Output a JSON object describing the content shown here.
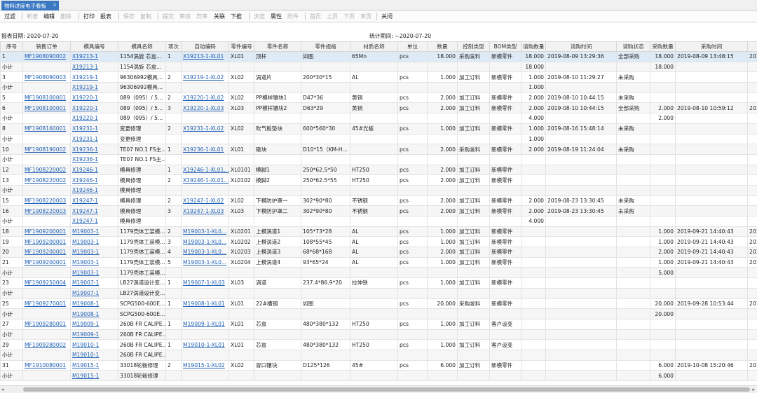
{
  "window": {
    "tab_title": "物料进度电子看板",
    "close_glyph": "×"
  },
  "toolbar": {
    "items": [
      {
        "label": "过滤",
        "enabled": true
      },
      {
        "label": "新增",
        "enabled": false
      },
      {
        "label": "编辑",
        "enabled": true
      },
      {
        "label": "删除",
        "enabled": false
      },
      {
        "label": "打印",
        "enabled": true
      },
      {
        "label": "报表",
        "enabled": true
      },
      {
        "label": "保存",
        "enabled": false
      },
      {
        "label": "复制",
        "enabled": false
      },
      {
        "label": "提交",
        "enabled": false
      },
      {
        "label": "审核",
        "enabled": false
      },
      {
        "label": "弃审",
        "enabled": false
      },
      {
        "label": "关联",
        "enabled": true
      },
      {
        "label": "下推",
        "enabled": true
      },
      {
        "label": "浏览",
        "enabled": false
      },
      {
        "label": "属性",
        "enabled": true
      },
      {
        "label": "附件",
        "enabled": false
      },
      {
        "label": "首页",
        "enabled": false
      },
      {
        "label": "上页",
        "enabled": false
      },
      {
        "label": "下页",
        "enabled": false
      },
      {
        "label": "末页",
        "enabled": false
      },
      {
        "label": "关闭",
        "enabled": true
      }
    ]
  },
  "info": {
    "report_date": "报表日期: 2020-07-20",
    "stat_period": "统计期间: ~2020-07-20"
  },
  "table": {
    "columns": [
      "序号",
      "销售订单",
      "模具编号",
      "模具名称",
      "项次",
      "自动编码",
      "零件编号",
      "零件名称",
      "零件规格",
      "材质名称",
      "单位",
      "数量",
      "控制类型",
      "BOM类型",
      "请购数量",
      "请购时间",
      "请购状态",
      "采购数量",
      "采购时间",
      ""
    ],
    "rows": [
      [
        "1",
        "MF1908090002",
        "X19213-1",
        "1154涡旋 芯盒...",
        "1",
        "X19213-1-XL01",
        "XL01",
        "顶杆",
        "如图",
        "65Mn",
        "pcs",
        "18.000",
        "采购发料",
        "新模零件",
        "18.000",
        "2019-08-09 13:29:36",
        "全部采购",
        "18.000",
        "2019-08-09 13:48:15",
        "2019-"
      ],
      [
        "小计",
        "",
        "X19213-1",
        "1154涡旋 芯盒...",
        "",
        "",
        "",
        "",
        "",
        "",
        "",
        "",
        "",
        "",
        "18.000",
        "",
        "",
        "18.000",
        "",
        ""
      ],
      [
        "3",
        "MF1908090003",
        "X19219-1",
        "96306992模具...",
        "2",
        "X19219-1-XL02",
        "XL02",
        "涡道片",
        "200*30*15",
        "AL",
        "pcs",
        "1.000",
        "加工订料",
        "新模零件",
        "1.000",
        "2019-08-10 11:29:27",
        "未采购",
        "",
        "",
        ""
      ],
      [
        "小计",
        "",
        "X19219-1",
        "96306992模具...",
        "",
        "",
        "",
        "",
        "",
        "",
        "",
        "",
        "",
        "",
        "1.000",
        "",
        "",
        "",
        "",
        ""
      ],
      [
        "5",
        "MF1908100001",
        "X19220-1",
        "089（095）/ 5...",
        "2",
        "X19220-1-XL02",
        "XL02",
        "PP模样镶块1",
        "D47*36",
        "黄铜",
        "pcs",
        "2.000",
        "加工订料",
        "新模零件",
        "2.000",
        "2019-08-10 10:44:15",
        "未采购",
        "",
        "",
        ""
      ],
      [
        "6",
        "MF1908100001",
        "X19220-1",
        "089（095）/ 5...",
        "3",
        "X19220-1-XL03",
        "XL03",
        "PP模样镶块2",
        "D63*29",
        "黄铜",
        "pcs",
        "2.000",
        "加工订料",
        "新模零件",
        "2.000",
        "2019-08-10 10:44:15",
        "全部采购",
        "2.000",
        "2019-08-10 10:59:12",
        "2019-"
      ],
      [
        "小计",
        "",
        "X19220-1",
        "089（095）/ 5...",
        "",
        "",
        "",
        "",
        "",
        "",
        "",
        "",
        "",
        "",
        "4.000",
        "",
        "",
        "2.000",
        "",
        ""
      ],
      [
        "8",
        "MF1908160001",
        "X19231-1",
        "变更修理",
        "2",
        "X19231-1-XL02",
        "XL02",
        "吹气板垫块",
        "600*560*30",
        "45#光板",
        "pcs",
        "1.000",
        "加工订料",
        "新模零件",
        "1.000",
        "2019-08-16 15:48:14",
        "未采购",
        "",
        "",
        ""
      ],
      [
        "小计",
        "",
        "X19231-1",
        "变更修理",
        "",
        "",
        "",
        "",
        "",
        "",
        "",
        "",
        "",
        "",
        "1.000",
        "",
        "",
        "",
        "",
        ""
      ],
      [
        "10",
        "MF1908190002",
        "X19236-1",
        "TE07 NO.1 FS主...",
        "1",
        "X19236-1-XL01",
        "XL01",
        "砸块",
        "D10*15（KM-H...",
        "",
        "pcs",
        "2.000",
        "采购发料",
        "新模零件",
        "2.000",
        "2019-08-19 11:24:04",
        "未采购",
        "",
        "",
        ""
      ],
      [
        "小计",
        "",
        "X19236-1",
        "TE07 NO.1 FS主...",
        "",
        "",
        "",
        "",
        "",
        "",
        "",
        "",
        "",
        "",
        "",
        "",
        "",
        "",
        "",
        ""
      ],
      [
        "12",
        "MF1908220002",
        "X19246-1",
        "模具修理",
        "1",
        "X19246-1-XL01...",
        "XL0101",
        "模脚1",
        "250*62.5*50",
        "HT250",
        "pcs",
        "2.000",
        "加工订料",
        "新模零件",
        "",
        "",
        "",
        "",
        "",
        ""
      ],
      [
        "13",
        "MF1908220002",
        "X19246-1",
        "模具修理",
        "2",
        "X19246-1-XL01...",
        "XL0102",
        "模脚2",
        "250*62.5*55",
        "HT250",
        "pcs",
        "2.000",
        "加工订料",
        "新模零件",
        "",
        "",
        "",
        "",
        "",
        ""
      ],
      [
        "小计",
        "",
        "X19246-1",
        "模具修理",
        "",
        "",
        "",
        "",
        "",
        "",
        "",
        "",
        "",
        "",
        "",
        "",
        "",
        "",
        "",
        ""
      ],
      [
        "15",
        "MF1908220003",
        "X19247-1",
        "模具修理",
        "2",
        "X19247-1-XL02",
        "XL02",
        "下模防护罩一",
        "302*90*80",
        "不锈钢",
        "pcs",
        "2.000",
        "加工订料",
        "新模零件",
        "2.000",
        "2019-08-23 13:30:45",
        "未采购",
        "",
        "",
        ""
      ],
      [
        "16",
        "MF1908220003",
        "X19247-1",
        "模具修理",
        "3",
        "X19247-1-XL03",
        "XL03",
        "下模防护罩二",
        "302*90*80",
        "不锈钢",
        "pcs",
        "2.000",
        "加工订料",
        "新模零件",
        "2.000",
        "2019-08-23 13:30:45",
        "未采购",
        "",
        "",
        ""
      ],
      [
        "小计",
        "",
        "X19247-1",
        "模具修理",
        "",
        "",
        "",
        "",
        "",
        "",
        "",
        "",
        "",
        "",
        "4.000",
        "",
        "",
        "",
        "",
        ""
      ],
      [
        "18",
        "MF1909200001",
        "M19003-1",
        "1179壳体工装模...",
        "2",
        "M19003-1-XL0...",
        "XL0201",
        "上模涡道1",
        "105*73*28",
        "AL",
        "pcs",
        "1.000",
        "加工订料",
        "新模零件",
        "",
        "",
        "",
        "1.000",
        "2019-09-21 14:40:43",
        "2019-"
      ],
      [
        "19",
        "MF1909200001",
        "M19003-1",
        "1179壳体工装模...",
        "3",
        "M19003-1-XL0...",
        "XL0202",
        "上模涡道2",
        "108*55*45",
        "AL",
        "pcs",
        "1.000",
        "加工订料",
        "新模零件",
        "",
        "",
        "",
        "1.000",
        "2019-09-21 14:40:43",
        "2019-"
      ],
      [
        "20",
        "MF1909200001",
        "M19003-1",
        "1179壳体工装模...",
        "4",
        "M19003-1-XL0...",
        "XL0203",
        "上模涡道3",
        "68*68*168",
        "AL",
        "pcs",
        "2.000",
        "加工订料",
        "新模零件",
        "",
        "",
        "",
        "2.000",
        "2019-09-21 14:40:43",
        "2019-"
      ],
      [
        "21",
        "MF1909200001",
        "M19003-1",
        "1179壳体工装模...",
        "5",
        "M19003-1-XL0...",
        "XL0204",
        "上模涡道4",
        "93*65*24",
        "AL",
        "pcs",
        "1.000",
        "加工订料",
        "新模零件",
        "",
        "",
        "",
        "1.000",
        "2019-09-21 14:40:43",
        "2019-"
      ],
      [
        "小计",
        "",
        "M19003-1",
        "1179壳体工装模...",
        "",
        "",
        "",
        "",
        "",
        "",
        "",
        "",
        "",
        "",
        "",
        "",
        "",
        "5.000",
        "",
        ""
      ],
      [
        "23",
        "MF1909250004",
        "M19007-1",
        "LB27涡道设计变...",
        "1",
        "M19007-1-XL03",
        "XL03",
        "涡道",
        "237.4*86.9*20",
        "拉伸铁",
        "pcs",
        "1.000",
        "加工订料",
        "新模零件",
        "",
        "",
        "",
        "",
        "",
        ""
      ],
      [
        "小计",
        "",
        "M19007-1",
        "LB27涡道设计变...",
        "",
        "",
        "",
        "",
        "",
        "",
        "",
        "",
        "",
        "",
        "",
        "",
        "",
        "",
        "",
        ""
      ],
      [
        "25",
        "MF1909270001",
        "M19008-1",
        "SCPG500-600E...",
        "1",
        "M19008-1-XL01",
        "XL01",
        "22#槽钢",
        "如图",
        "",
        "pcs",
        "20.000",
        "采购发料",
        "新模零件",
        "",
        "",
        "",
        "20.000",
        "2019-09-28 10:53:44",
        "2019-"
      ],
      [
        "小计",
        "",
        "M19008-1",
        "SCPG500-600E...",
        "",
        "",
        "",
        "",
        "",
        "",
        "",
        "",
        "",
        "",
        "",
        "",
        "",
        "20.000",
        "",
        ""
      ],
      [
        "27",
        "MF1909280001",
        "M19009-1",
        "260B FR CALIPE...",
        "1",
        "M19009-1-XL01",
        "XL01",
        "芯盒",
        "480*380*132",
        "HT250",
        "pcs",
        "1.000",
        "加工订料",
        "客户设变",
        "",
        "",
        "",
        "",
        "",
        ""
      ],
      [
        "小计",
        "",
        "M19009-1",
        "260B FR CALIPE...",
        "",
        "",
        "",
        "",
        "",
        "",
        "",
        "",
        "",
        "",
        "",
        "",
        "",
        "",
        "",
        ""
      ],
      [
        "29",
        "MF1909280002",
        "M19010-1",
        "260B FR CALIPE...",
        "1",
        "M19010-1-XL01",
        "XL01",
        "芯盒",
        "480*380*132",
        "HT250",
        "pcs",
        "1.000",
        "加工订料",
        "客户设变",
        "",
        "",
        "",
        "",
        "",
        ""
      ],
      [
        "小计",
        "",
        "M19010-1",
        "260B FR CALIPE...",
        "",
        "",
        "",
        "",
        "",
        "",
        "",
        "",
        "",
        "",
        "",
        "",
        "",
        "",
        "",
        ""
      ],
      [
        "31",
        "MF1910080001",
        "M19015-1",
        "33018轮毂修理",
        "2",
        "M19015-1-XL02",
        "XL02",
        "冒口镶块",
        "D125*126",
        "45#",
        "pcs",
        "6.000",
        "加工订料",
        "新模零件",
        "",
        "",
        "",
        "6.000",
        "2019-10-08 15:20:46",
        "2019-"
      ],
      [
        "小计",
        "",
        "M19015-1",
        "33018轮毂修理",
        "",
        "",
        "",
        "",
        "",
        "",
        "",
        "",
        "",
        "",
        "",
        "",
        "",
        "6.000",
        "",
        ""
      ]
    ]
  },
  "scrollbar": {
    "left_glyph": "◂",
    "right_glyph": "▸"
  }
}
